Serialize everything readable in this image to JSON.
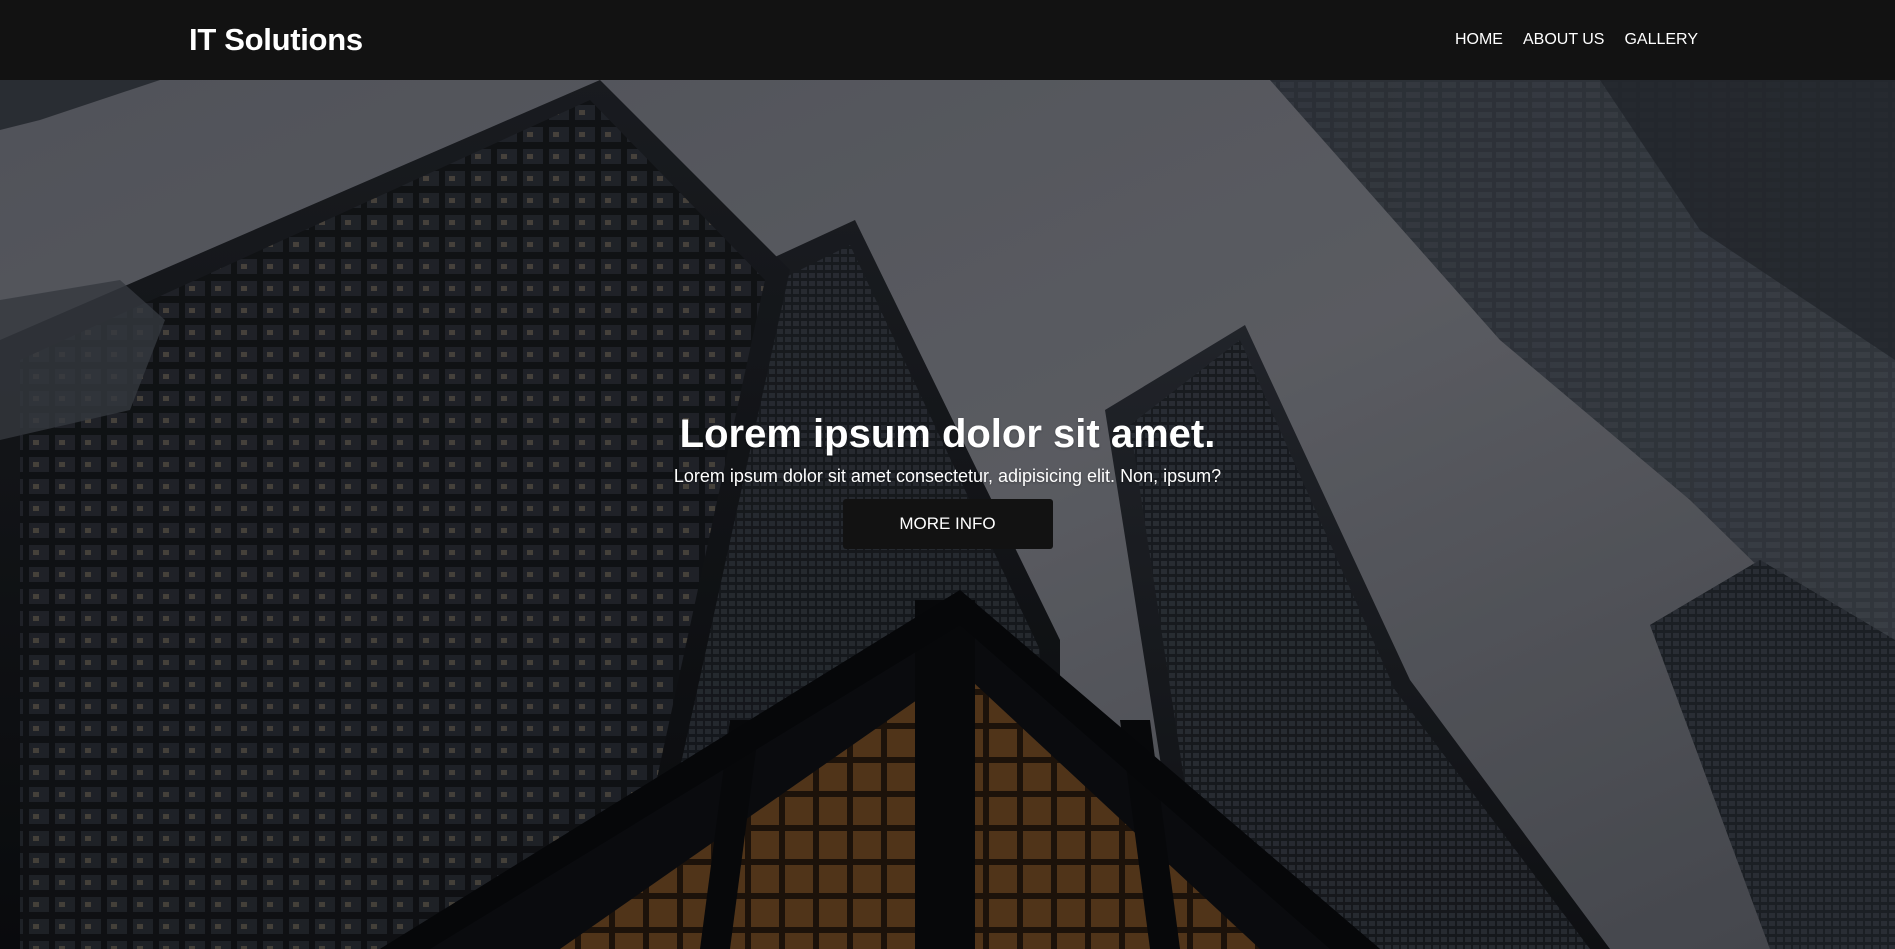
{
  "header": {
    "brand": "IT Solutions",
    "nav": [
      {
        "label": "HOME"
      },
      {
        "label": "ABOUT US"
      },
      {
        "label": "GALLERY"
      }
    ]
  },
  "hero": {
    "title": "Lorem ipsum dolor sit amet.",
    "subtitle": "Lorem ipsum dolor sit amet consectetur, adipisicing elit. Non, ipsum?",
    "button_label": "MORE INFO",
    "background_image": "skyscrapers-upward-view"
  },
  "colors": {
    "header_bg": "#121212",
    "button_bg": "#121212",
    "text": "#ffffff",
    "sky": "#6d7079"
  }
}
